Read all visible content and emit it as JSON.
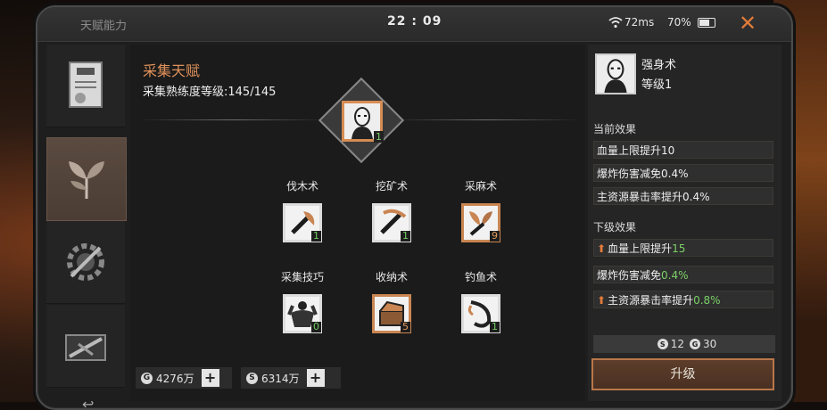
{
  "topbar": {
    "title": "天赋能力",
    "clock": "22 : 09",
    "ping": "72ms",
    "battery": "70%",
    "close": "✕"
  },
  "sidebar": {
    "items": [
      {
        "icon": "certificate-icon",
        "active": false
      },
      {
        "icon": "gathering-leaf-icon",
        "active": true
      },
      {
        "icon": "gear-tool-icon",
        "active": false
      },
      {
        "icon": "weapon-icon",
        "active": false
      }
    ]
  },
  "main": {
    "heading": "采集天赋",
    "proficiency": "采集熟练度等级:145/145",
    "core": {
      "icon": "bald-head-icon",
      "level": "1"
    },
    "skills": [
      {
        "name": "伐木术",
        "icon": "axe-icon",
        "level": "1"
      },
      {
        "name": "挖矿术",
        "icon": "pickaxe-icon",
        "level": "1"
      },
      {
        "name": "采麻术",
        "icon": "hemp-gather-icon",
        "level": "9"
      },
      {
        "name": "采集技巧",
        "icon": "muscle-man-icon",
        "level": "0"
      },
      {
        "name": "收纳术",
        "icon": "storage-crate-icon",
        "level": "5"
      },
      {
        "name": "钓鱼术",
        "icon": "fishing-icon",
        "level": "1"
      }
    ],
    "currency": [
      {
        "symbol": "G",
        "amount": "4276万"
      },
      {
        "symbol": "S",
        "amount": "6314万"
      }
    ]
  },
  "detail": {
    "name": "强身术",
    "level": "等级1",
    "current_title": "当前效果",
    "current": [
      "血量上限提升10",
      "爆炸伤害减免0.4%",
      "主资源暴击率提升0.4%"
    ],
    "next_title": "下级效果",
    "next": [
      {
        "text": "血量上限提升",
        "value": "15"
      },
      {
        "text": "爆炸伤害减免",
        "value": "0.4%"
      },
      {
        "text": "主资源暴击率提升",
        "value": "0.8%"
      }
    ],
    "cost": [
      {
        "symbol": "S",
        "amount": "12"
      },
      {
        "symbol": "G",
        "amount": "30"
      }
    ],
    "upgrade": "升级"
  },
  "colors": {
    "accent": "#e0915a",
    "green": "#7bd067",
    "button_border": "#b9774a"
  }
}
